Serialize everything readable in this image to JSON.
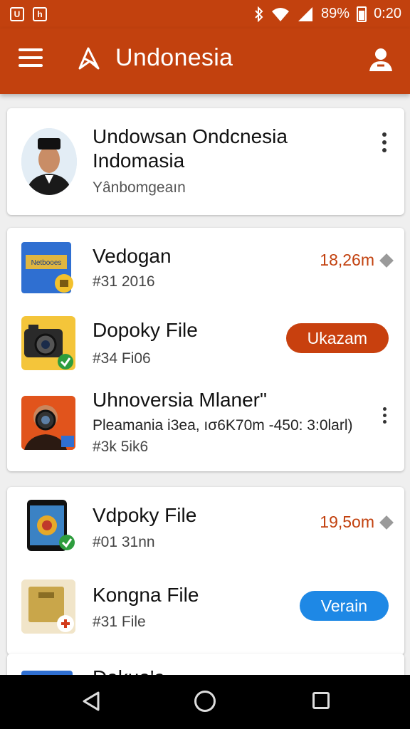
{
  "status_bar": {
    "battery": "89%",
    "time": "0:20"
  },
  "app_bar": {
    "title": "Undonesia"
  },
  "profile": {
    "name_line1": "Undowsan Ondcnesia",
    "name_line2": "Indomasia",
    "subtitle": "Yânbomgeaın"
  },
  "files": [
    {
      "title": "Vedogan",
      "subtitle": "#31 2016",
      "size": "18,26m"
    },
    {
      "title": "Dopoky File",
      "subtitle": "#34 Fi06",
      "action": "Ukazam"
    },
    {
      "title": "Uhnoversia Mlaner\"",
      "detail": "Pleamania i3ea, ıσ6K70m  -450: 3:0larl)",
      "subtitle": "#3k 5ik6"
    }
  ],
  "files2": [
    {
      "title": "Vdpoky File",
      "subtitle": "#01 31nn",
      "size": "19,5om"
    },
    {
      "title": "Kongna File",
      "subtitle": "#31 File",
      "action": "Verain"
    }
  ],
  "partial_row": {
    "title": "Dakua'a"
  },
  "colors": {
    "primary": "#c2410e",
    "accent_blue": "#1e88e5"
  }
}
